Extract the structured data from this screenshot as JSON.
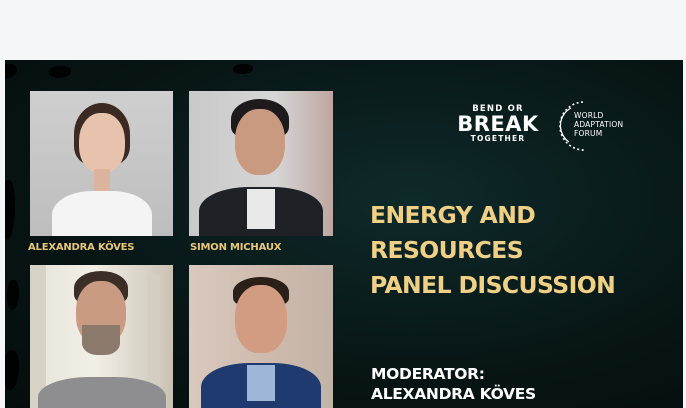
{
  "speakers": [
    {
      "name": "ALEXANDRA KÖVES"
    },
    {
      "name": "SIMON MICHAUX"
    },
    {
      "name": ""
    },
    {
      "name": ""
    }
  ],
  "logos": {
    "bend_or_break": {
      "top": "BEND OR",
      "middle": "BREAK",
      "bottom": "TOGETHER"
    },
    "world_adaptation_forum": {
      "line1": "WORLD",
      "line2": "ADAPTATION",
      "line3": "FORUM"
    }
  },
  "headline": {
    "line1": "ENERGY AND",
    "line2": "RESOURCES",
    "line3": "PANEL DISCUSSION"
  },
  "moderator": {
    "label": "MODERATOR:",
    "name": "ALEXANDRA KÖVES"
  },
  "colors": {
    "background": "#081616",
    "headline": "#f0d084",
    "name_labels": "#e8c878",
    "moderator": "#ffffff"
  }
}
